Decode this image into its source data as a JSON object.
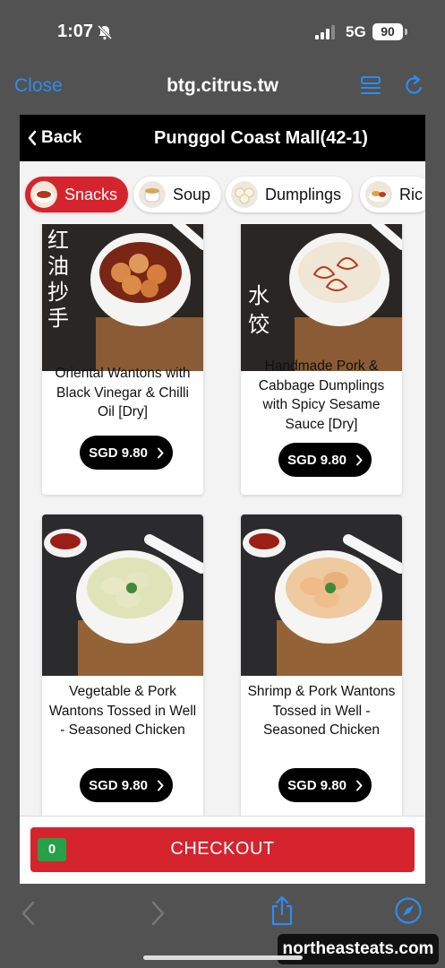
{
  "status_bar": {
    "time": "1:07",
    "network": "5G",
    "battery": "90"
  },
  "browser": {
    "close_label": "Close",
    "url": "btg.citrus.tw",
    "accent_color": "#2e8cf0"
  },
  "header": {
    "back_label": "Back",
    "store_name": "Punggol Coast Mall(42-1)"
  },
  "categories": [
    {
      "label": "Snacks",
      "active": true
    },
    {
      "label": "Soup",
      "active": false
    },
    {
      "label": "Dumplings",
      "active": false
    },
    {
      "label": "Ric",
      "active": false
    }
  ],
  "products": [
    {
      "name": "Oriental Wantons with Black Vinegar & Chilli Oil [Dry]",
      "price": "SGD 9.80",
      "calligraphy": "红油抄手"
    },
    {
      "name": "Handmade Pork & Cabbage Dumplings with Spicy Sesame Sauce [Dry]",
      "price": "SGD 9.80",
      "calligraphy": "水饺"
    },
    {
      "name": "Vegetable & Pork Wantons Tossed in Well - Seasoned Chicken",
      "price": "SGD 9.80"
    },
    {
      "name": "Shrimp & Pork Wantons Tossed in Well - Seasoned Chicken",
      "price": "SGD 9.80"
    }
  ],
  "checkout": {
    "label": "CHECKOUT",
    "count": "0"
  },
  "watermark": "northeasteats.com",
  "colors": {
    "brand_red": "#d5242e",
    "badge_green": "#27a04a"
  }
}
